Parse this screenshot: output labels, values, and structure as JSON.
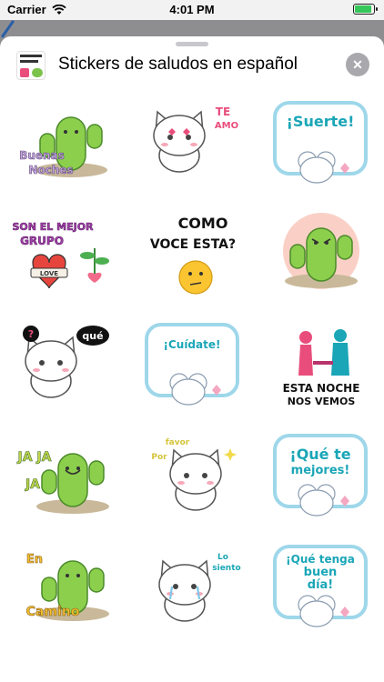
{
  "status_bar": {
    "carrier": "Carrier",
    "time": "4:01 PM"
  },
  "sheet": {
    "title": "Stickers de saludos en español",
    "close_glyph": "✕"
  },
  "stickers": [
    {
      "text1": "Buenas",
      "text2": "Noches",
      "kind": "cactus-night"
    },
    {
      "text1": "TE",
      "text2": "AMO",
      "kind": "cat-love"
    },
    {
      "text1": "¡Suerte!",
      "text2": "",
      "kind": "mouse-bubble"
    },
    {
      "text1": "SON EL MEJOR",
      "text2": "GRUPO",
      "badge": "LOVE",
      "kind": "heart-group"
    },
    {
      "text1": "COMO",
      "text2": "VOCE ESTA?",
      "kind": "thinking"
    },
    {
      "text1": "",
      "text2": "",
      "kind": "cactus-angry"
    },
    {
      "text1": "?",
      "text2": "qué",
      "kind": "cat-question"
    },
    {
      "text1": "¡Cuídate!",
      "text2": "",
      "kind": "mouse-bubble"
    },
    {
      "text1": "ESTA NOCHE",
      "text2": "NOS VEMOS",
      "kind": "couple"
    },
    {
      "text1": "JA JA",
      "text2": "JA",
      "kind": "cactus-laugh"
    },
    {
      "text1": "Por",
      "text2": "favor",
      "kind": "cat-please"
    },
    {
      "text1": "¡Qué te",
      "text2": "mejores!",
      "kind": "mouse-bubble"
    },
    {
      "text1": "En",
      "text2": "Camino",
      "kind": "cactus-run"
    },
    {
      "text1": "Lo",
      "text2": "siento",
      "kind": "cat-sorry"
    },
    {
      "text1": "¡Qué tenga",
      "text2": "buen",
      "text3": "día!",
      "kind": "mouse-bubble"
    }
  ],
  "colors": {
    "pink": "#e94d7c",
    "green": "#7cc24c",
    "blue": "#3a9bd8",
    "teal": "#1aa6b7"
  }
}
